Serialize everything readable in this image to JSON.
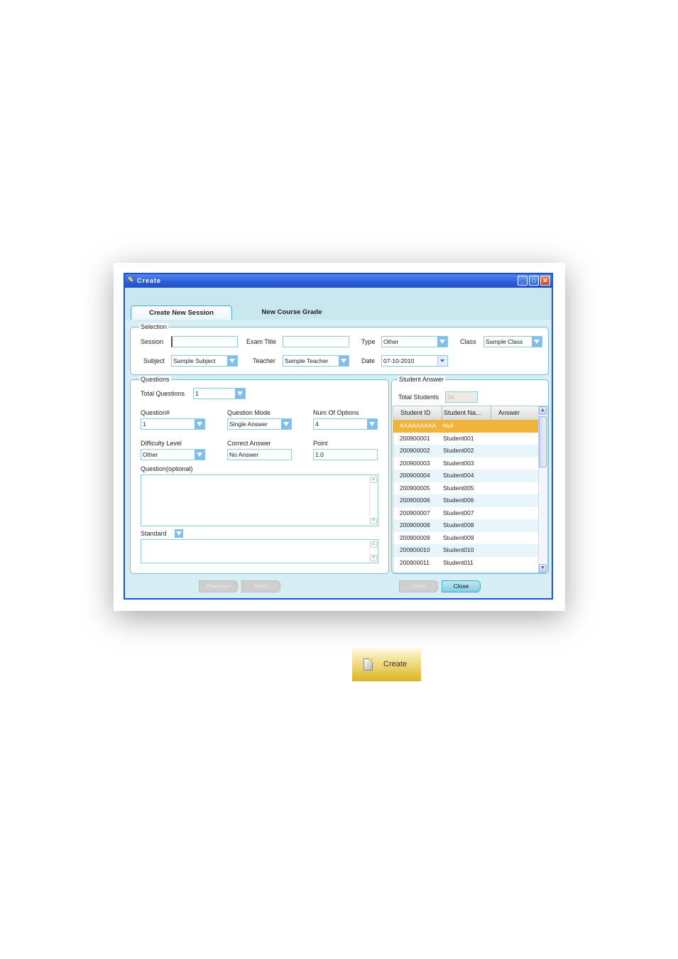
{
  "window": {
    "title": "Create"
  },
  "tabs": [
    {
      "label": "Create New Session"
    },
    {
      "label": "New Course Grade"
    }
  ],
  "selection": {
    "legend": "Selection",
    "session_label": "Session",
    "session_value": "",
    "exam_title_label": "Exam Title",
    "exam_title_value": "",
    "type_label": "Type",
    "type_value": "Other",
    "class_label": "Class",
    "class_value": "Sample Class",
    "subject_label": "Subject",
    "subject_value": "Sample Subject",
    "teacher_label": "Teacher",
    "teacher_value": "Sample Teacher",
    "date_label": "Date",
    "date_value": "07-10-2010"
  },
  "questions": {
    "legend": "Questions",
    "total_label": "Total Questions",
    "total_value": "1",
    "qnum_label": "Question#",
    "qnum_value": "1",
    "mode_label": "Question Mode",
    "mode_value": "Single Answer",
    "options_label": "Num Of Options",
    "options_value": "4",
    "difficulty_label": "Difficulty Level",
    "difficulty_value": "Other",
    "correct_label": "Correct Answer",
    "correct_value": "No Answer",
    "point_label": "Point",
    "point_value": "1.0",
    "question_label": "Question(optional)",
    "standard_label": "Standard",
    "prev_label": "Previous",
    "next_label": "Next"
  },
  "student_answer": {
    "legend": "Student Answer",
    "total_label": "Total Students",
    "total_value": "34",
    "columns": [
      "Student ID",
      "Student Na...",
      "Answer"
    ],
    "rows": [
      {
        "id": "AAAAAAAAA",
        "name": "Null",
        "answer": ""
      },
      {
        "id": "200900001",
        "name": "Student001",
        "answer": ""
      },
      {
        "id": "200900002",
        "name": "Student002",
        "answer": ""
      },
      {
        "id": "200900003",
        "name": "Student003",
        "answer": ""
      },
      {
        "id": "200900004",
        "name": "Student004",
        "answer": ""
      },
      {
        "id": "200900005",
        "name": "Student005",
        "answer": ""
      },
      {
        "id": "200900006",
        "name": "Student006",
        "answer": ""
      },
      {
        "id": "200900007",
        "name": "Student007",
        "answer": ""
      },
      {
        "id": "200900008",
        "name": "Student008",
        "answer": ""
      },
      {
        "id": "200900009",
        "name": "Student009",
        "answer": ""
      },
      {
        "id": "200900010",
        "name": "Student010",
        "answer": ""
      },
      {
        "id": "200900011",
        "name": "Student011",
        "answer": ""
      }
    ],
    "save_label": "Save",
    "close_label": "Close"
  },
  "create_button": {
    "label": "Create"
  },
  "colors": {
    "title_bar": "#2b5ed6",
    "selected_row": "#f0b43c",
    "panel_border": "#79c0d4"
  }
}
